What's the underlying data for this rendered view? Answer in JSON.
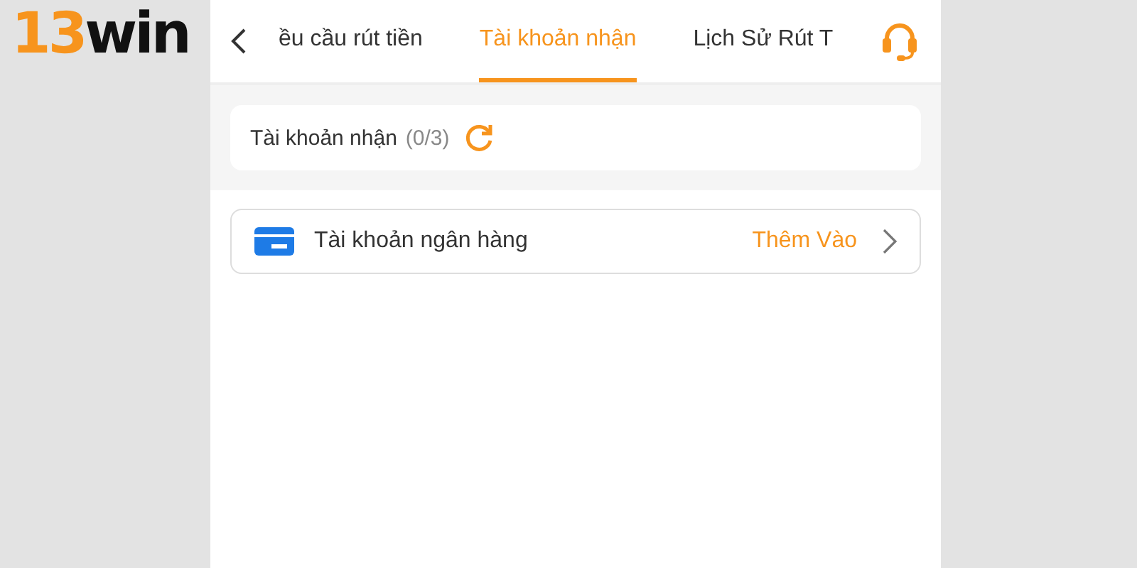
{
  "logo": {
    "number": "13",
    "word": "win"
  },
  "tabs": [
    {
      "label": "ều cầu rút tiền",
      "selected": false
    },
    {
      "label": "Tài khoản nhận",
      "selected": true
    },
    {
      "label": "Lịch Sử Rút T",
      "selected": false
    }
  ],
  "summary": {
    "label": "Tài khoản nhận",
    "count": "(0/3)"
  },
  "accounts": [
    {
      "label": "Tài khoản ngân hàng",
      "action": "Thêm Vào"
    }
  ]
}
